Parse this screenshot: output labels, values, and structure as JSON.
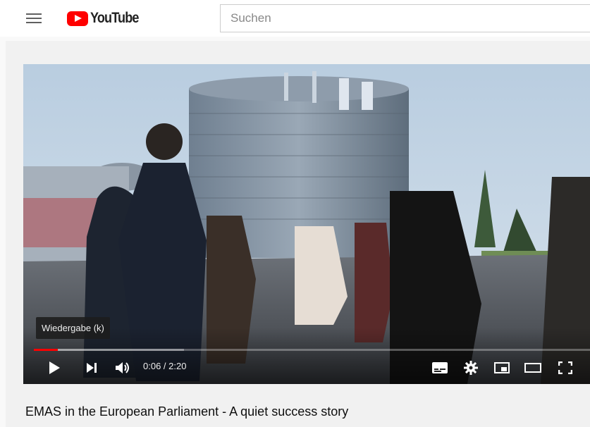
{
  "masthead": {
    "logo_text": "YouTube",
    "search_placeholder": "Suchen"
  },
  "player": {
    "tooltip": "Wiedergabe (k)",
    "current_time": "0:06",
    "duration": "2:20",
    "time_display": "0:06 / 2:20",
    "progress_fraction": 0.043,
    "buffered_fraction": 0.27,
    "accent_color": "#ff0000"
  },
  "video": {
    "title": "EMAS in the European Parliament - A quiet success story"
  },
  "icons": [
    "menu-icon",
    "youtube-logo-icon",
    "play-icon",
    "next-icon",
    "volume-icon",
    "subtitles-icon",
    "settings-icon",
    "miniplayer-icon",
    "theater-mode-icon",
    "fullscreen-icon"
  ]
}
